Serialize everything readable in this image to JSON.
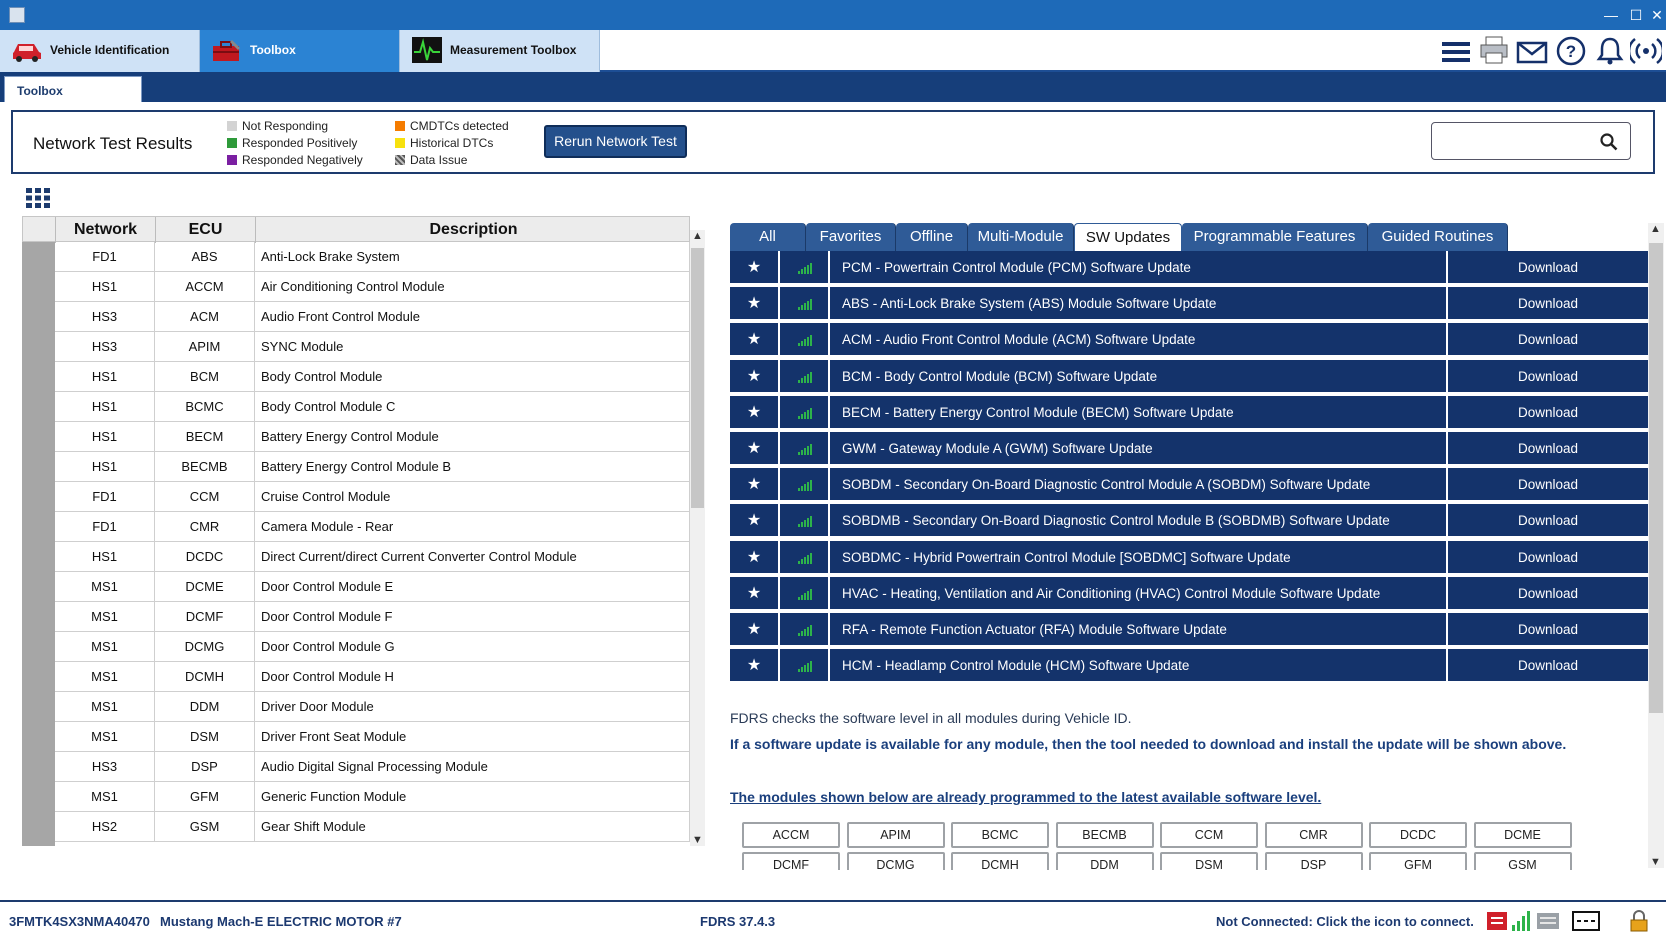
{
  "window": {
    "minimize": "—",
    "maximize": "☐",
    "close": "✕"
  },
  "app_tabs": [
    {
      "label": "Vehicle Identification",
      "icon": "car-icon"
    },
    {
      "label": "Toolbox",
      "icon": "toolbox-icon"
    },
    {
      "label": "Measurement Toolbox",
      "icon": "oscilloscope-icon"
    }
  ],
  "top_icons": [
    "menu-icon",
    "printer-icon",
    "mail-icon",
    "help-icon",
    "bell-icon",
    "wireless-icon"
  ],
  "subtab": {
    "label": "Toolbox"
  },
  "network_panel": {
    "title": "Network Test Results",
    "legend": [
      {
        "label": "Not Responding",
        "color": "#d3d3d3"
      },
      {
        "label": "Responded Positively",
        "color": "#2e9a3a"
      },
      {
        "label": "Responded Negatively",
        "color": "#7b1fa2"
      },
      {
        "label": "CMDTCs detected",
        "color": "#f57c00"
      },
      {
        "label": "Historical DTCs",
        "color": "#f7e10e"
      },
      {
        "label": "Data Issue",
        "color": "#777777"
      }
    ],
    "rerun_label": "Rerun Network Test",
    "search_placeholder": ""
  },
  "ecu_table": {
    "headers": {
      "network": "Network",
      "ecu": "ECU",
      "description": "Description"
    },
    "rows": [
      {
        "network": "FD1",
        "ecu": "ABS",
        "description": "Anti-Lock Brake System"
      },
      {
        "network": "HS1",
        "ecu": "ACCM",
        "description": "Air Conditioning Control Module"
      },
      {
        "network": "HS3",
        "ecu": "ACM",
        "description": "Audio Front Control Module"
      },
      {
        "network": "HS3",
        "ecu": "APIM",
        "description": "SYNC Module"
      },
      {
        "network": "HS1",
        "ecu": "BCM",
        "description": "Body Control Module"
      },
      {
        "network": "HS1",
        "ecu": "BCMC",
        "description": "Body Control Module C"
      },
      {
        "network": "HS1",
        "ecu": "BECM",
        "description": "Battery Energy Control Module"
      },
      {
        "network": "HS1",
        "ecu": "BECMB",
        "description": "Battery Energy Control Module B"
      },
      {
        "network": "FD1",
        "ecu": "CCM",
        "description": "Cruise Control Module"
      },
      {
        "network": "FD1",
        "ecu": "CMR",
        "description": "Camera Module - Rear"
      },
      {
        "network": "HS1",
        "ecu": "DCDC",
        "description": "Direct Current/direct Current Converter Control Module"
      },
      {
        "network": "MS1",
        "ecu": "DCME",
        "description": "Door Control Module E"
      },
      {
        "network": "MS1",
        "ecu": "DCMF",
        "description": "Door Control Module F"
      },
      {
        "network": "MS1",
        "ecu": "DCMG",
        "description": "Door Control Module G"
      },
      {
        "network": "MS1",
        "ecu": "DCMH",
        "description": "Door Control Module H"
      },
      {
        "network": "MS1",
        "ecu": "DDM",
        "description": "Driver Door Module"
      },
      {
        "network": "MS1",
        "ecu": "DSM",
        "description": "Driver Front Seat Module"
      },
      {
        "network": "HS3",
        "ecu": "DSP",
        "description": "Audio Digital Signal Processing Module"
      },
      {
        "network": "MS1",
        "ecu": "GFM",
        "description": "Generic Function Module"
      },
      {
        "network": "HS2",
        "ecu": "GSM",
        "description": "Gear Shift Module"
      }
    ]
  },
  "right_tabs": [
    "All",
    "Favorites",
    "Offline",
    "Multi-Module",
    "SW Updates",
    "Programmable Features",
    "Guided Routines"
  ],
  "active_right_tab": "SW Updates",
  "updates": [
    {
      "name": "PCM - Powertrain Control Module (PCM) Software Update",
      "action": "Download"
    },
    {
      "name": "ABS - Anti-Lock Brake System (ABS) Module Software Update",
      "action": "Download"
    },
    {
      "name": "ACM - Audio Front Control Module (ACM) Software Update",
      "action": "Download"
    },
    {
      "name": "BCM - Body Control Module (BCM) Software Update",
      "action": "Download"
    },
    {
      "name": "BECM - Battery Energy Control Module (BECM) Software Update",
      "action": "Download"
    },
    {
      "name": "GWM - Gateway Module A (GWM) Software Update",
      "action": "Download"
    },
    {
      "name": "SOBDM - Secondary On-Board Diagnostic Control Module A (SOBDM) Software Update",
      "action": "Download"
    },
    {
      "name": "SOBDMB - Secondary On-Board Diagnostic Control Module B (SOBDMB) Software Update",
      "action": "Download"
    },
    {
      "name": "SOBDMC - Hybrid Powertrain Control Module [SOBDMC] Software Update",
      "action": "Download"
    },
    {
      "name": "HVAC - Heating, Ventilation and Air Conditioning (HVAC) Control Module Software Update",
      "action": "Download"
    },
    {
      "name": "RFA - Remote Function Actuator (RFA) Module Software Update",
      "action": "Download"
    },
    {
      "name": "HCM - Headlamp Control Module (HCM) Software Update",
      "action": "Download"
    }
  ],
  "info": {
    "line1": "FDRS checks the software level in all modules during Vehicle ID.",
    "line2": "If a software update is available for any module, then the tool needed to download and install the update will be shown above.",
    "line3": "The modules shown below are already programmed to the latest available software level."
  },
  "programmed_modules": [
    "ACCM",
    "APIM",
    "BCMC",
    "BECMB",
    "CCM",
    "CMR",
    "DCDC",
    "DCME",
    "DCMF",
    "DCMG",
    "DCMH",
    "DDM",
    "DSM",
    "DSP",
    "GFM",
    "GSM"
  ],
  "status": {
    "vin": "3FMTK4SX3NMA40470",
    "vehicle": "Mustang Mach-E ELECTRIC MOTOR #7",
    "version": "FDRS 37.4.3",
    "connection": "Not Connected: Click the icon to connect."
  },
  "colors": {
    "titlebar": "#1e6ab8",
    "row_blue": "#14336b",
    "tab_blue": "#2f5b97",
    "signal_green": "#2db34a"
  }
}
